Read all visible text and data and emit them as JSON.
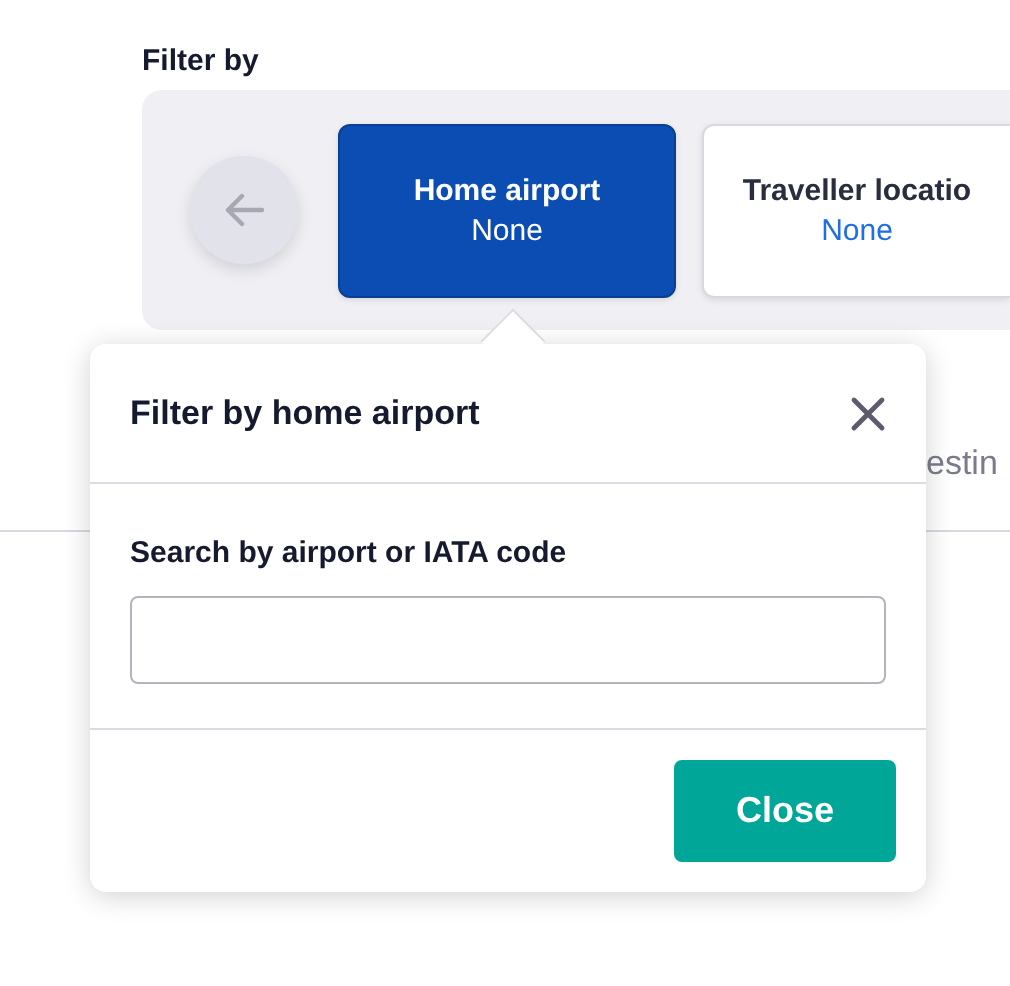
{
  "filter_heading": "Filter by",
  "filters": [
    {
      "label": "Home airport",
      "value": "None",
      "selected": true
    },
    {
      "label": "Traveller locatio",
      "value": "None",
      "selected": false
    }
  ],
  "background_tab": {
    "label": "estin"
  },
  "popup": {
    "title": "Filter by home airport",
    "field_label": "Search by airport or IATA code",
    "button": "Close"
  }
}
